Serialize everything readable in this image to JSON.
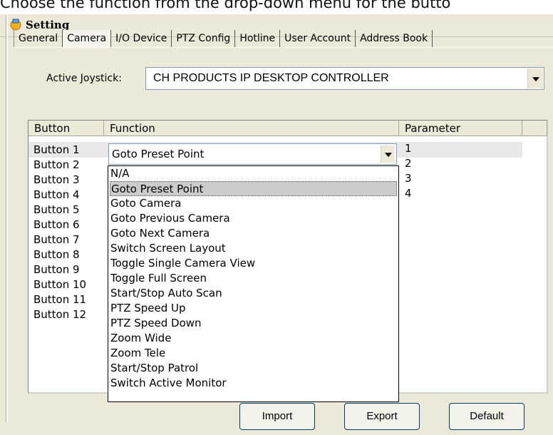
{
  "caption": "Choose the function from the drop-down menu for the butto",
  "window": {
    "title": "Setting"
  },
  "tabs": [
    {
      "label": "General"
    },
    {
      "label": "Camera"
    },
    {
      "label": "I/O Device"
    },
    {
      "label": "PTZ Config"
    },
    {
      "label": "Hotline"
    },
    {
      "label": "User Account"
    },
    {
      "label": "Address Book"
    }
  ],
  "joystick": {
    "label": "Active Joystick:",
    "value": "CH PRODUCTS IP DESKTOP CONTROLLER"
  },
  "grid": {
    "headers": [
      "Button",
      "Function",
      "Parameter"
    ],
    "buttons": [
      "Button 1",
      "Button 2",
      "Button 3",
      "Button 4",
      "Button 5",
      "Button 6",
      "Button 7",
      "Button 8",
      "Button 9",
      "Button 10",
      "Button 11",
      "Button 12"
    ],
    "parameters": [
      "1",
      "2",
      "3",
      "4"
    ],
    "selected_function": "Goto Preset Point"
  },
  "dropdown_options": [
    "N/A",
    "Goto Preset Point",
    "Goto Camera",
    "Goto Previous Camera",
    "Goto Next Camera",
    "Switch Screen Layout",
    "Toggle Single Camera View",
    "Toggle Full Screen",
    "Start/Stop Auto Scan",
    "PTZ Speed Up",
    "PTZ Speed Down",
    "Zoom Wide",
    "Zoom Tele",
    "Start/Stop Patrol",
    "Switch Active Monitor"
  ],
  "highlighted_option": "Goto Preset Point",
  "buttons": {
    "import": "Import",
    "export": "Export",
    "default": "Default"
  },
  "icons": {
    "window": "settings-app-icon",
    "dropdown": "chevron-down-icon"
  }
}
